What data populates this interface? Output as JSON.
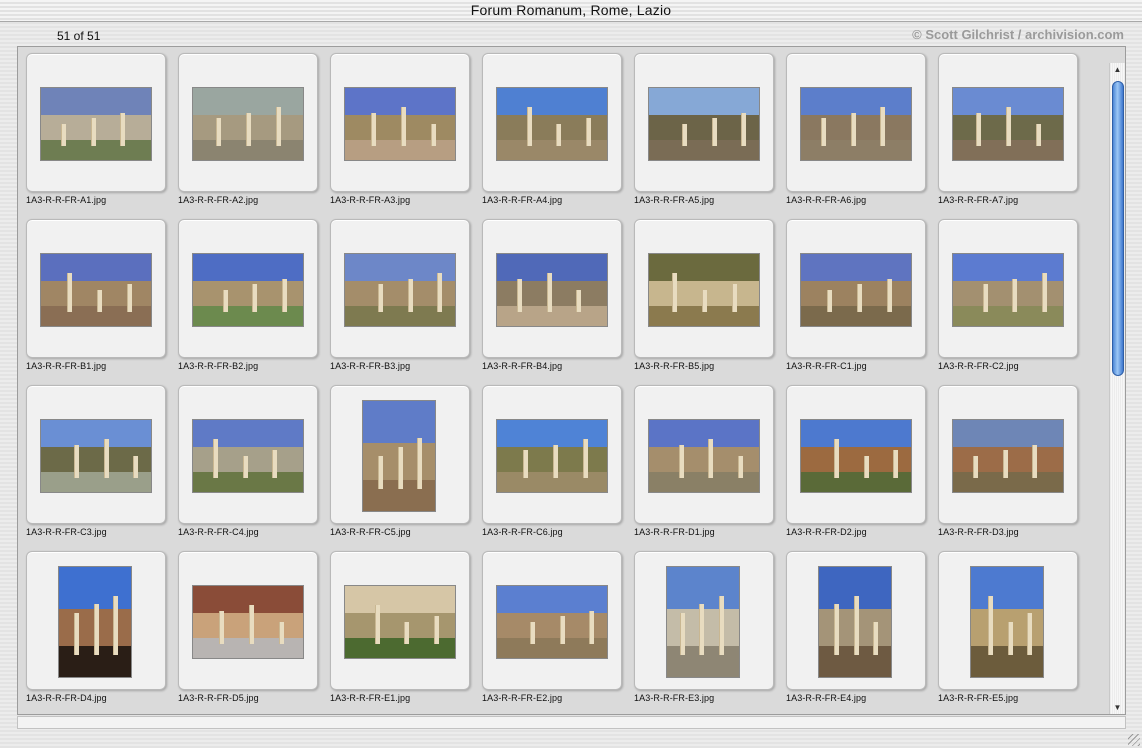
{
  "window": {
    "title": "Forum Romanum, Rome, Lazio"
  },
  "header": {
    "counter": "51 of 51",
    "copyright": "© Scott Gilchrist / archivision.com"
  },
  "scroll": {
    "position_fraction": 0.0,
    "visible_fraction": 0.47
  },
  "thumbnails": [
    {
      "file": "1A3-R-R-FR-A1.jpg",
      "orientation": "landscape",
      "sky": "#6f83b8",
      "mid": "#b7ad98",
      "ground": "#6e7d52"
    },
    {
      "file": "1A3-R-R-FR-A2.jpg",
      "orientation": "landscape",
      "sky": "#9aa6a0",
      "mid": "#a69a80",
      "ground": "#8b8470"
    },
    {
      "file": "1A3-R-R-FR-A3.jpg",
      "orientation": "landscape",
      "sky": "#5d74c8",
      "mid": "#9e8a62",
      "ground": "#b79e82"
    },
    {
      "file": "1A3-R-R-FR-A4.jpg",
      "orientation": "landscape",
      "sky": "#4f80d2",
      "mid": "#8a7c5a",
      "ground": "#9a8868"
    },
    {
      "file": "1A3-R-R-FR-A5.jpg",
      "orientation": "landscape",
      "sky": "#86a8d6",
      "mid": "#6c6448",
      "ground": "#7a6c55"
    },
    {
      "file": "1A3-R-R-FR-A6.jpg",
      "orientation": "landscape",
      "sky": "#5c7ecb",
      "mid": "#8a7860",
      "ground": "#8d7e66"
    },
    {
      "file": "1A3-R-R-FR-A7.jpg",
      "orientation": "landscape",
      "sky": "#6a8bd2",
      "mid": "#6d6a4a",
      "ground": "#816f58"
    },
    {
      "file": "1A3-R-R-FR-B1.jpg",
      "orientation": "landscape",
      "sky": "#5b6fbe",
      "mid": "#a08664",
      "ground": "#8a6e54"
    },
    {
      "file": "1A3-R-R-FR-B2.jpg",
      "orientation": "landscape",
      "sky": "#4e6dc4",
      "mid": "#a8936e",
      "ground": "#6c8a4e"
    },
    {
      "file": "1A3-R-R-FR-B3.jpg",
      "orientation": "landscape",
      "sky": "#6d87c8",
      "mid": "#a48d6a",
      "ground": "#7e7a50"
    },
    {
      "file": "1A3-R-R-FR-B4.jpg",
      "orientation": "landscape",
      "sky": "#5069b8",
      "mid": "#8c7c62",
      "ground": "#b8a488"
    },
    {
      "file": "1A3-R-R-FR-B5.jpg",
      "orientation": "landscape",
      "sky": "#6b6a3e",
      "mid": "#c7b68e",
      "ground": "#8b7a4e"
    },
    {
      "file": "1A3-R-R-FR-C1.jpg",
      "orientation": "landscape",
      "sky": "#5f74c0",
      "mid": "#9c8260",
      "ground": "#7b6a4c"
    },
    {
      "file": "1A3-R-R-FR-C2.jpg",
      "orientation": "landscape",
      "sky": "#5c7bd0",
      "mid": "#a39070",
      "ground": "#8a8a5a"
    },
    {
      "file": "1A3-R-R-FR-C3.jpg",
      "orientation": "landscape",
      "sky": "#6a8fd4",
      "mid": "#6c6a48",
      "ground": "#9a9f8a"
    },
    {
      "file": "1A3-R-R-FR-C4.jpg",
      "orientation": "landscape",
      "sky": "#5f7ac6",
      "mid": "#a6a08a",
      "ground": "#6a7846"
    },
    {
      "file": "1A3-R-R-FR-C5.jpg",
      "orientation": "portrait",
      "sky": "#5f7cc8",
      "mid": "#a68e6a",
      "ground": "#8a6e50"
    },
    {
      "file": "1A3-R-R-FR-C6.jpg",
      "orientation": "landscape",
      "sky": "#4f83d6",
      "mid": "#7d7a4c",
      "ground": "#9a8a66"
    },
    {
      "file": "1A3-R-R-FR-D1.jpg",
      "orientation": "landscape",
      "sky": "#5b74c6",
      "mid": "#a58e6c",
      "ground": "#8a8066"
    },
    {
      "file": "1A3-R-R-FR-D2.jpg",
      "orientation": "landscape",
      "sky": "#4d79cf",
      "mid": "#9c6a40",
      "ground": "#5a6a38"
    },
    {
      "file": "1A3-R-R-FR-D3.jpg",
      "orientation": "landscape",
      "sky": "#6e86b6",
      "mid": "#9c6c48",
      "ground": "#7a6a4a"
    },
    {
      "file": "1A3-R-R-FR-D4.jpg",
      "orientation": "portrait",
      "sky": "#3e70d0",
      "mid": "#9a6c4a",
      "ground": "#2a1e16"
    },
    {
      "file": "1A3-R-R-FR-D5.jpg",
      "orientation": "landscape",
      "sky": "#8a4c38",
      "mid": "#c9a27a",
      "ground": "#b8b4b2"
    },
    {
      "file": "1A3-R-R-FR-E1.jpg",
      "orientation": "landscape",
      "sky": "#d6c6a6",
      "mid": "#a6966e",
      "ground": "#4c6a30"
    },
    {
      "file": "1A3-R-R-FR-E2.jpg",
      "orientation": "landscape",
      "sky": "#5b7fd0",
      "mid": "#a68a68",
      "ground": "#8e7a5a"
    },
    {
      "file": "1A3-R-R-FR-E3.jpg",
      "orientation": "portrait",
      "sky": "#5c84cc",
      "mid": "#c4bca8",
      "ground": "#8e8674"
    },
    {
      "file": "1A3-R-R-FR-E4.jpg",
      "orientation": "portrait",
      "sky": "#3e66c0",
      "mid": "#a49478",
      "ground": "#6e5a42"
    },
    {
      "file": "1A3-R-R-FR-E5.jpg",
      "orientation": "portrait",
      "sky": "#4d7ad0",
      "mid": "#b8a070",
      "ground": "#6c5c3c"
    }
  ]
}
